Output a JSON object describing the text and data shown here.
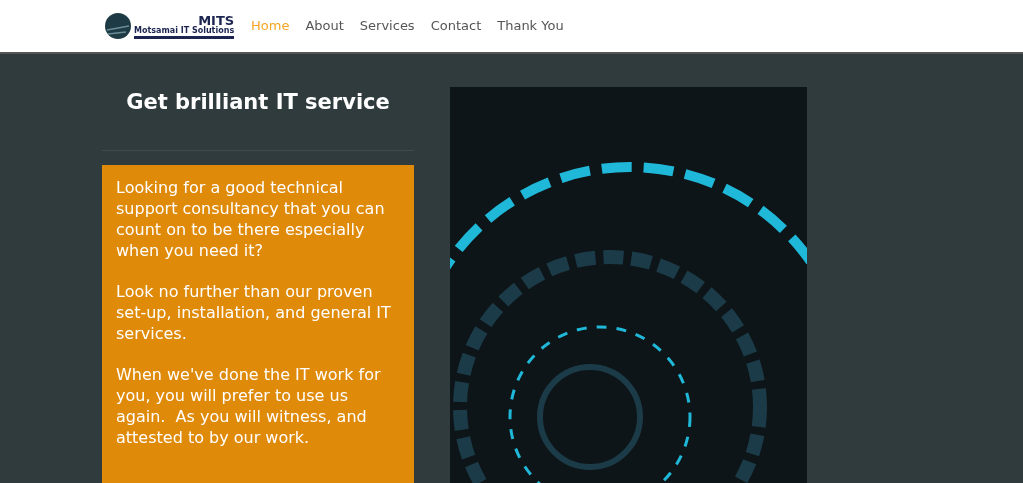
{
  "logo": {
    "title": "MITS",
    "subtitle": "Motsamai IT Solutions"
  },
  "nav": [
    {
      "label": "Home",
      "selected": true
    },
    {
      "label": "About",
      "selected": false
    },
    {
      "label": "Services",
      "selected": false
    },
    {
      "label": "Contact",
      "selected": false
    },
    {
      "label": "Thank You",
      "selected": false
    }
  ],
  "hero": {
    "heading": "Get brilliant IT service",
    "paragraphs": [
      "Looking for a good technical support consultancy that you can count on to be there especially when you need it?",
      "Look no further than our proven set-up, installation, and general IT services.",
      "When we've done the IT work for you, you will prefer to use us again.  As you will witness, and attested to by our work."
    ]
  }
}
